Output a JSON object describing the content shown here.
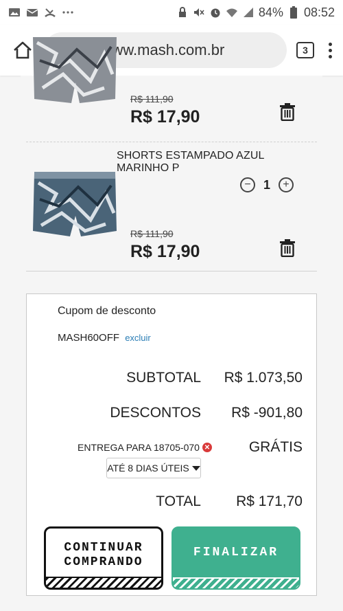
{
  "status_bar": {
    "left_icons": [
      "image-icon",
      "mail-icon",
      "missed-call-icon",
      "more-icon"
    ],
    "right_icons": [
      "lock-icon",
      "mute-icon",
      "alarm-icon",
      "wifi-icon",
      "signal-icon"
    ],
    "battery": "84%",
    "time": "08:52"
  },
  "browser": {
    "url": "ps://www.mash.com.br",
    "tab_count": "3"
  },
  "cart": {
    "items": [
      {
        "title": "",
        "old_price": "R$ 111,90",
        "price": "R$ 17,90"
      },
      {
        "title": "SHORTS ESTAMPADO AZUL MARINHO P",
        "quantity": "1",
        "old_price": "R$ 111,90",
        "price": "R$ 17,90"
      }
    ]
  },
  "summary": {
    "coupon_label": "Cupom de desconto",
    "coupon_code": "MASH60OFF",
    "coupon_remove": "excluir",
    "subtotal_label": "SUBTOTAL",
    "subtotal_value": "R$ 1.073,50",
    "discounts_label": "DESCONTOS",
    "discounts_value": "R$ -901,80",
    "shipping_label": "ENTREGA PARA 18705-070",
    "shipping_value": "GRÁTIS",
    "shipping_option": "ATÉ 8 DIAS ÚTEIS",
    "total_label": "TOTAL",
    "total_value": "R$ 171,70",
    "continue_label": "CONTINUAR\nCOMPRANDO",
    "finalize_label": "FINALIZAR",
    "accent_color": "#3fb08f"
  }
}
